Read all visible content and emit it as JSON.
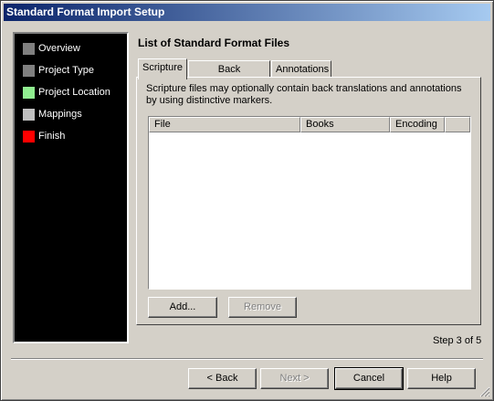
{
  "window": {
    "title": "Standard Format Import Setup"
  },
  "sidebar": {
    "steps": [
      {
        "label": "Overview",
        "color": "#808080"
      },
      {
        "label": "Project Type",
        "color": "#808080"
      },
      {
        "label": "Project Location",
        "color": "#90ee90"
      },
      {
        "label": "Mappings",
        "color": "#c0c0c0"
      },
      {
        "label": "Finish",
        "color": "#ff0000"
      }
    ]
  },
  "main": {
    "heading": "List of Standard Format Files",
    "tabs": [
      {
        "label": "Scripture",
        "active": true
      },
      {
        "label": "Back Translation",
        "active": false
      },
      {
        "label": "Annotations",
        "active": false
      }
    ],
    "description": "Scripture files may optionally contain back translations and annotations by using distinctive markers.",
    "list": {
      "columns": [
        "File",
        "Books",
        "Encoding"
      ],
      "rows": []
    },
    "add_label": "Add...",
    "remove_label": "Remove",
    "step_text": "Step 3 of 5"
  },
  "footer": {
    "back_label": "< Back",
    "next_label": "Next >",
    "cancel_label": "Cancel",
    "help_label": "Help"
  }
}
